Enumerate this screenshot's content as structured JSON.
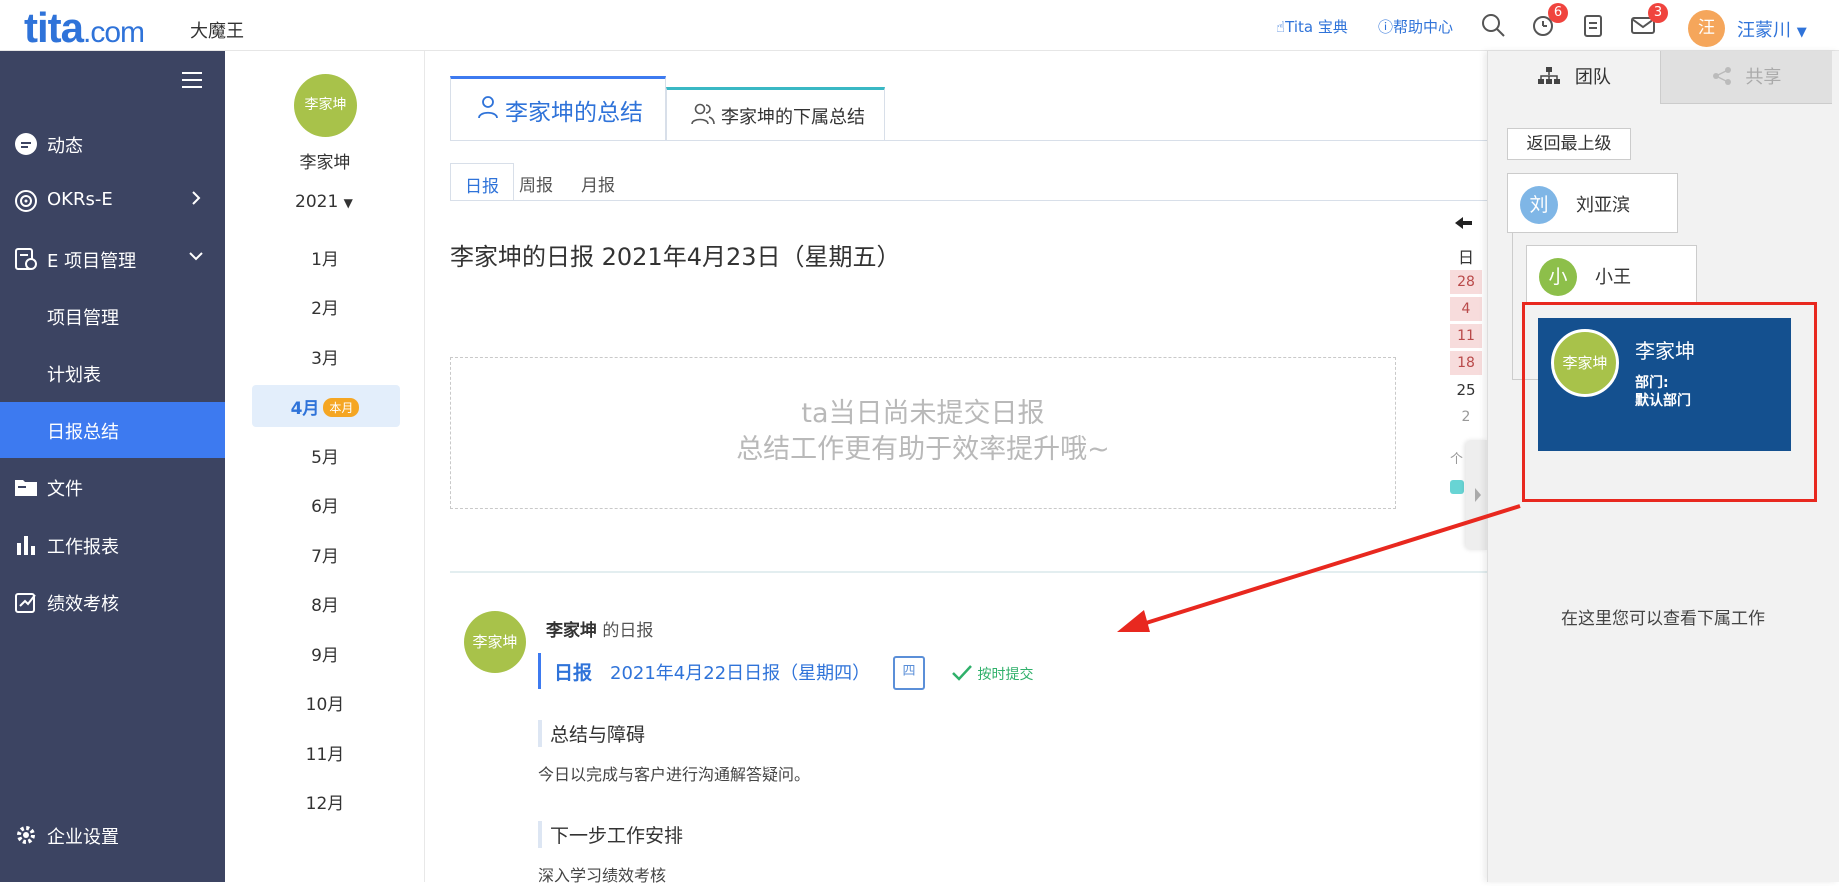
{
  "header": {
    "logo": "tita",
    "logo_suffix": ".com",
    "company": "大魔王",
    "links": [
      "Tita 宝典",
      "帮助中心"
    ],
    "badges": {
      "reminders": "6",
      "messages": "3"
    },
    "user_avatar_char": "汪",
    "user_name": "汪蒙川"
  },
  "nav": {
    "items": [
      {
        "label": "动态",
        "icon": "chat-bubble-icon"
      },
      {
        "label": "OKRs-E",
        "icon": "target-icon"
      },
      {
        "label": "E 项目管理",
        "icon": "project-icon"
      },
      {
        "label": "项目管理"
      },
      {
        "label": "计划表"
      },
      {
        "label": "日报总结"
      },
      {
        "label": "文件",
        "icon": "folder-icon"
      },
      {
        "label": "工作报表",
        "icon": "bar-chart-icon"
      },
      {
        "label": "绩效考核",
        "icon": "trend-icon"
      }
    ],
    "settings": "企业设置"
  },
  "months": {
    "avatar": "李家坤",
    "name": "李家坤",
    "year": "2021",
    "list": [
      "1月",
      "2月",
      "3月",
      "4月",
      "5月",
      "6月",
      "7月",
      "8月",
      "9月",
      "10月",
      "11月",
      "12月"
    ],
    "current_tag": "本月"
  },
  "main": {
    "tabs": [
      "李家坤的总结",
      "李家坤的下属总结"
    ],
    "subtabs": [
      "日报",
      "周报",
      "月报"
    ],
    "report_title": "李家坤的日报 2021年4月23日（星期五）",
    "empty_line1": "ta当日尚未提交日报",
    "empty_line2": "总结工作更有助于效率提升哦~",
    "entry": {
      "avatar": "李家坤",
      "name": "李家坤",
      "suffix": "的日报",
      "kind": "日报",
      "date": "2021年4月22日日报（星期四）",
      "weekday_icon": "四",
      "status": "按时提交",
      "sections": [
        {
          "title": "总结与障碍",
          "body": "今日以完成与客户进行沟通解答疑问。"
        },
        {
          "title": "下一步工作安排",
          "body": "深入学习绩效考核"
        }
      ]
    },
    "calendar": {
      "header": "日",
      "days": [
        "28",
        "4",
        "11",
        "18",
        "25",
        "2"
      ],
      "red_days": 4,
      "extra": "个"
    }
  },
  "rpanel": {
    "tabs": [
      "团队",
      "共享"
    ],
    "back_label": "返回最上级",
    "nodes": [
      {
        "avatar": "刘",
        "name": "刘亚滨",
        "color": "#7fb6e6"
      },
      {
        "avatar": "小",
        "name": "小王",
        "color": "#8dbf4a"
      }
    ],
    "selected": {
      "avatar": "李家坤",
      "name": "李家坤",
      "dept_label": "部门:",
      "dept": "默认部门"
    },
    "hint": "在这里您可以查看下属工作"
  }
}
